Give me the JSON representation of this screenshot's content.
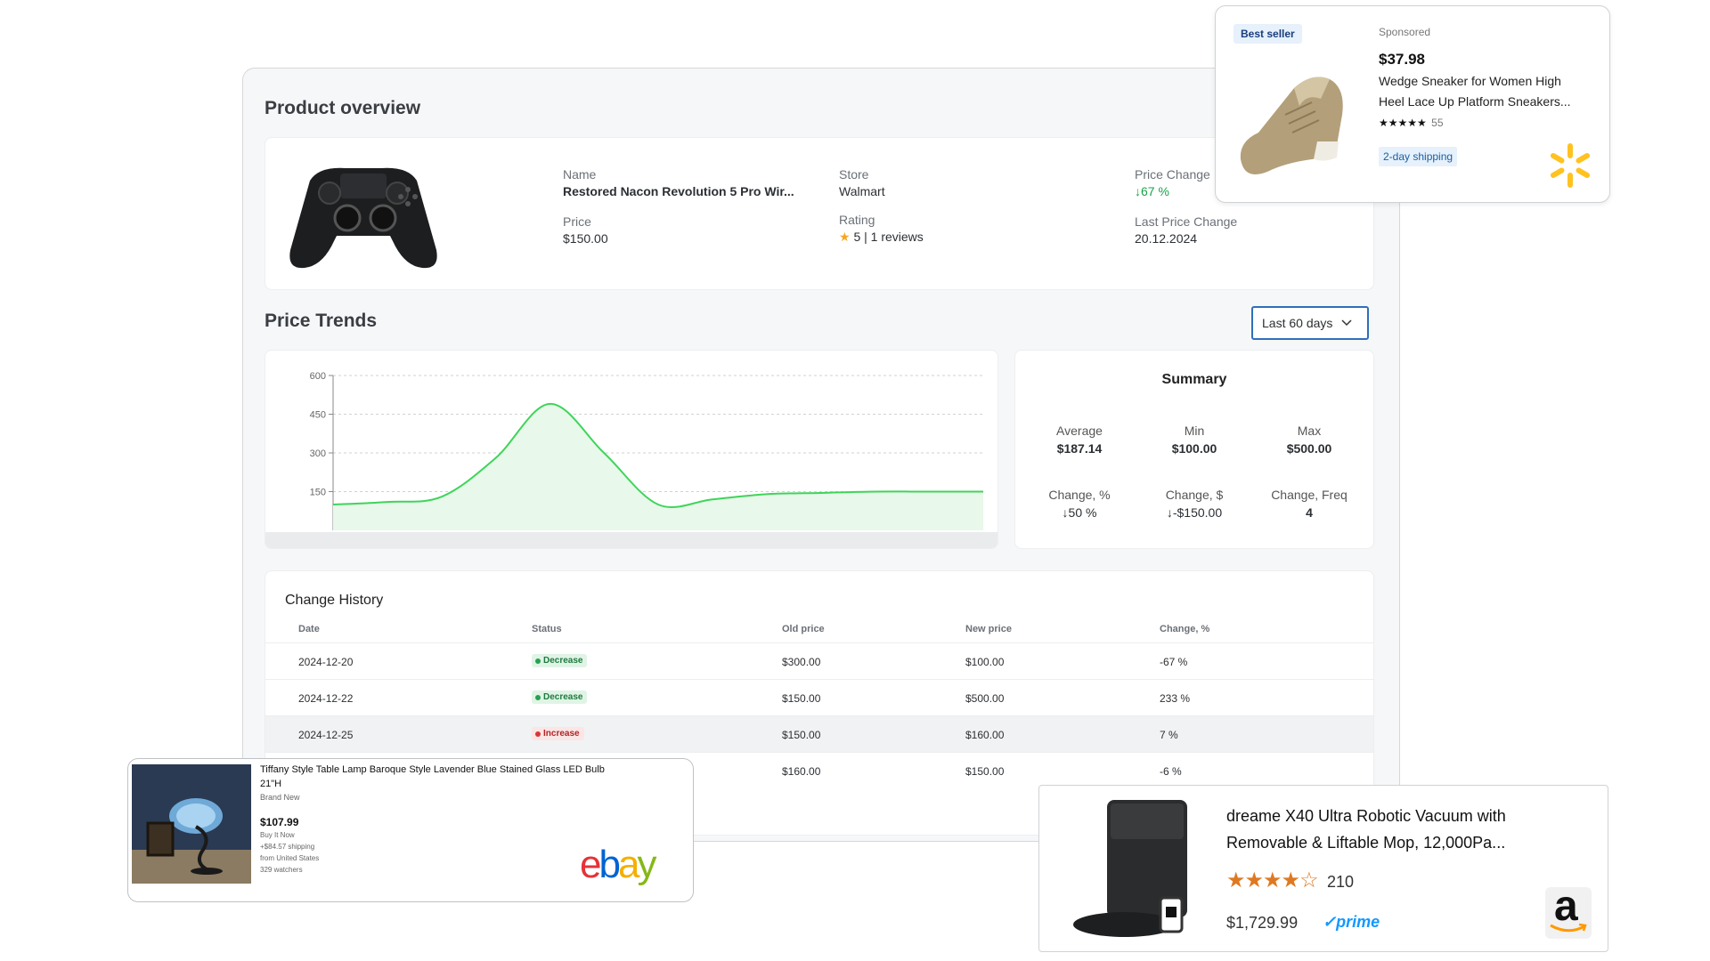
{
  "overview": {
    "title": "Product overview",
    "name_label": "Name",
    "name_value": "Restored Nacon Revolution 5 Pro Wir...",
    "price_label": "Price",
    "price_value": "$150.00",
    "store_label": "Store",
    "store_value": "Walmart",
    "rating_label": "Rating",
    "rating_star": "★",
    "rating_value": "5 | 1 reviews",
    "price_change_label": "Price Change",
    "price_change_value": "↓67 %",
    "last_change_label": "Last Price Change",
    "last_change_value": "20.12.2024"
  },
  "trends": {
    "title": "Price Trends",
    "range_select": "Last 60 days"
  },
  "chart_data": {
    "type": "area",
    "x": [
      0,
      5,
      10,
      15,
      20,
      25,
      30,
      35,
      40,
      45,
      50,
      55,
      60
    ],
    "values": [
      100,
      110,
      130,
      280,
      490,
      300,
      100,
      120,
      140,
      145,
      150,
      150,
      150
    ],
    "yticks": [
      150,
      300,
      450,
      600
    ],
    "ylim": [
      0,
      600
    ],
    "grid": true,
    "color": "#3fd45a"
  },
  "summary": {
    "title": "Summary",
    "average_label": "Average",
    "average_value": "$187.14",
    "min_label": "Min",
    "min_value": "$100.00",
    "max_label": "Max",
    "max_value": "$500.00",
    "change_pct_label": "Change, %",
    "change_pct_value": "↓50 %",
    "change_usd_label": "Change, $",
    "change_usd_value": "↓-$150.00",
    "change_freq_label": "Change, Freq",
    "change_freq_value": "4"
  },
  "history": {
    "title": "Change History",
    "headers": [
      "Date",
      "Status",
      "Old price",
      "New price",
      "Change, %"
    ],
    "rows": [
      {
        "date": "2024-12-20",
        "status": "Decrease",
        "old": "$300.00",
        "new": "$100.00",
        "change": "-67 %"
      },
      {
        "date": "2024-12-22",
        "status": "Decrease",
        "old": "$150.00",
        "new": "$500.00",
        "change": "233 %"
      },
      {
        "date": "2024-12-25",
        "status": "Increase",
        "old": "$150.00",
        "new": "$160.00",
        "change": "7 %"
      },
      {
        "date": "",
        "status": "",
        "old": "$160.00",
        "new": "$150.00",
        "change": "-6 %"
      }
    ]
  },
  "walmart_ad": {
    "badge": "Best seller",
    "sponsored": "Sponsored",
    "price": "$37.98",
    "title_line1": "Wedge Sneaker for Women High",
    "title_line2": "Heel Lace Up Platform Sneakers...",
    "stars": "★★★★★",
    "reviews": "55",
    "shipping": "2-day shipping",
    "brand_color": "#ffc220"
  },
  "ebay_ad": {
    "title_line1": "Tiffany Style Table Lamp Baroque Style Lavender Blue Stained Glass LED Bulb",
    "title_line2": "21\"H",
    "condition": "Brand New",
    "price": "$107.99",
    "buy_it_now": "Buy It Now",
    "shipping": "+$84.57 shipping",
    "from": "from United States",
    "watchers": "329 watchers",
    "logo_e": "e",
    "logo_b": "b",
    "logo_a": "a",
    "logo_y": "y"
  },
  "amazon_ad": {
    "title_line1": "dreame X40 Ultra Robotic Vacuum with",
    "title_line2": "Removable & Liftable Mop, 12,000Pa...",
    "stars": "★★★★☆",
    "reviews": "210",
    "price": "$1,729.99",
    "prime": "✓prime",
    "logo": "a"
  }
}
